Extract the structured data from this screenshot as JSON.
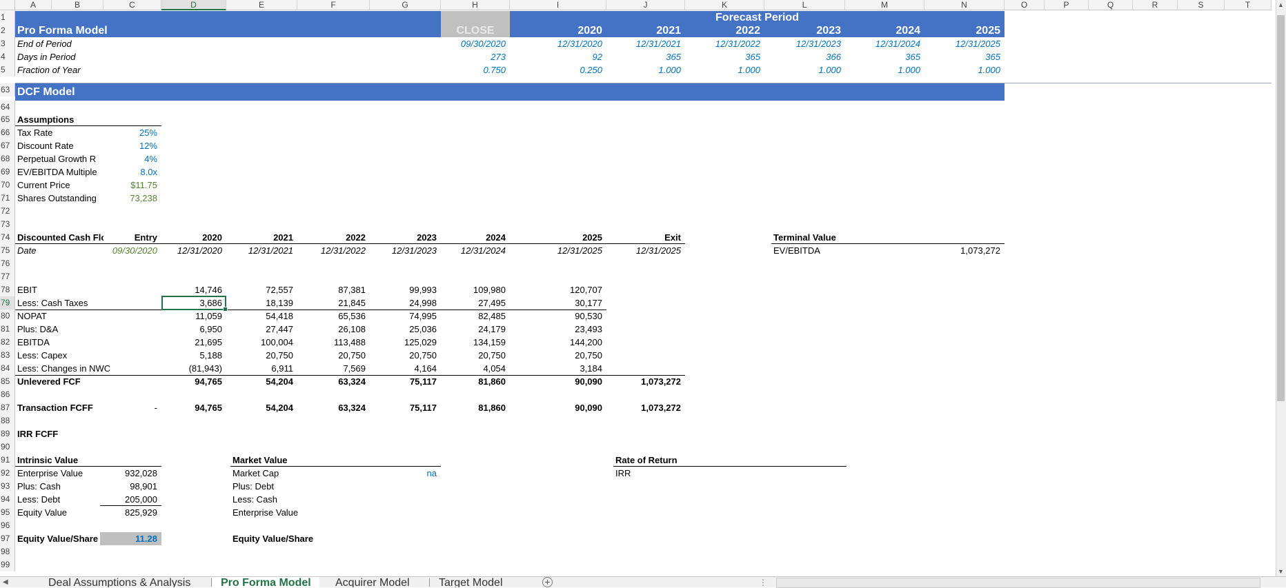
{
  "columns": [
    "A",
    "B",
    "C",
    "D",
    "E",
    "F",
    "G",
    "H",
    "I",
    "J",
    "K",
    "L",
    "M",
    "N",
    "O",
    "P",
    "Q",
    "R",
    "S",
    "T"
  ],
  "rows": [
    "1",
    "2",
    "3",
    "4",
    "5",
    "63",
    "64",
    "65",
    "66",
    "67",
    "68",
    "69",
    "70",
    "71",
    "72",
    "73",
    "74",
    "75",
    "76",
    "77",
    "78",
    "79",
    "80",
    "81",
    "82",
    "83",
    "84",
    "85",
    "86",
    "87",
    "88",
    "89",
    "90",
    "91",
    "92",
    "93",
    "94",
    "95",
    "96",
    "97",
    "98",
    "99"
  ],
  "header": {
    "forecast_label": "Forecast Period",
    "title": "Pro Forma Model",
    "close": "CLOSE",
    "years": [
      "2020",
      "2021",
      "2022",
      "2023",
      "2024",
      "2025"
    ],
    "end_of_period_label": "End of Period",
    "days_label": "Days in Period",
    "fraction_label": "Fraction of Year",
    "end_of_period": [
      "09/30/2020",
      "12/31/2020",
      "12/31/2021",
      "12/31/2022",
      "12/31/2023",
      "12/31/2024",
      "12/31/2025"
    ],
    "days": [
      "273",
      "92",
      "365",
      "365",
      "366",
      "365",
      "365"
    ],
    "fraction": [
      "0.750",
      "0.250",
      "1.000",
      "1.000",
      "1.000",
      "1.000",
      "1.000"
    ]
  },
  "dcf_title": "DCF Model",
  "assumptions": {
    "heading": "Assumptions",
    "items": [
      {
        "label": "Tax Rate",
        "value": "25%",
        "color": "blue"
      },
      {
        "label": "Discount Rate",
        "value": "12%",
        "color": "blue"
      },
      {
        "label": "Perpetual Growth R",
        "value": "4%",
        "color": "blue"
      },
      {
        "label": "EV/EBITDA Multiple",
        "value": "8.0x",
        "color": "blue"
      },
      {
        "label": "Current Price",
        "value": "$11.75",
        "color": "green"
      },
      {
        "label": "Shares Outstanding",
        "value": "73,238",
        "color": "green"
      }
    ]
  },
  "dcf_table": {
    "heading": "Discounted Cash Flo",
    "col_headers": [
      "Entry",
      "2020",
      "2021",
      "2022",
      "2023",
      "2024",
      "2025",
      "Exit"
    ],
    "date_label": "Date",
    "dates": [
      "09/30/2020",
      "12/31/2020",
      "12/31/2021",
      "12/31/2022",
      "12/31/2023",
      "12/31/2024",
      "12/31/2025",
      "12/31/2025"
    ],
    "lines": [
      {
        "label": "EBIT",
        "values": [
          "14,746",
          "72,557",
          "87,381",
          "99,993",
          "109,980",
          "120,707"
        ]
      },
      {
        "label": "Less: Cash Taxes",
        "values": [
          "3,686",
          "18,139",
          "21,845",
          "24,998",
          "27,495",
          "30,177"
        ]
      },
      {
        "label": "NOPAT",
        "values": [
          "11,059",
          "54,418",
          "65,536",
          "74,995",
          "82,485",
          "90,530"
        ]
      },
      {
        "label": "Plus: D&A",
        "values": [
          "6,950",
          "27,447",
          "26,108",
          "25,036",
          "24,179",
          "23,493"
        ]
      },
      {
        "label": "EBITDA",
        "values": [
          "21,695",
          "100,004",
          "113,488",
          "125,029",
          "134,159",
          "144,200"
        ]
      },
      {
        "label": "Less: Capex",
        "values": [
          "5,188",
          "20,750",
          "20,750",
          "20,750",
          "20,750",
          "20,750"
        ]
      },
      {
        "label": "Less: Changes in NWC",
        "values": [
          "(81,943)",
          "6,911",
          "7,569",
          "4,164",
          "4,054",
          "3,184"
        ]
      }
    ],
    "unlevered_label": "Unlevered FCF",
    "unlevered": [
      "94,765",
      "54,204",
      "63,324",
      "75,117",
      "81,860",
      "90,090",
      "1,073,272"
    ],
    "transaction_label": "Transaction FCFF",
    "transaction_entry": "-",
    "transaction": [
      "94,765",
      "54,204",
      "63,324",
      "75,117",
      "81,860",
      "90,090",
      "1,073,272"
    ],
    "irr_label": "IRR FCFF"
  },
  "terminal": {
    "heading": "Terminal Value",
    "label": "EV/EBITDA",
    "value": "1,073,272"
  },
  "intrinsic": {
    "heading": "Intrinsic Value",
    "items": [
      {
        "label": "Enterprise Value",
        "value": "932,028"
      },
      {
        "label": "Plus: Cash",
        "value": "98,901"
      },
      {
        "label": "Less: Debt",
        "value": "205,000"
      },
      {
        "label": "Equity Value",
        "value": "825,929"
      }
    ],
    "per_share_label": "Equity Value/Share",
    "per_share_value": "11.28"
  },
  "market": {
    "heading": "Market Value",
    "items": [
      "Market Cap",
      "Plus: Debt",
      "Less: Cash",
      "Enterprise Value"
    ],
    "market_cap_value": "na",
    "per_share_label": "Equity Value/Share"
  },
  "rate_of_return": {
    "heading": "Rate of Return",
    "label": "IRR"
  },
  "tabs": [
    "Deal Assumptions & Analysis",
    "Pro Forma Model",
    "Acquirer Model",
    "Target Model"
  ],
  "colors": {
    "band": "#4472c4",
    "close_fill": "#c0c0c0",
    "input_blue": "#0070c0",
    "link_green": "#548235",
    "excel_green": "#217346"
  }
}
